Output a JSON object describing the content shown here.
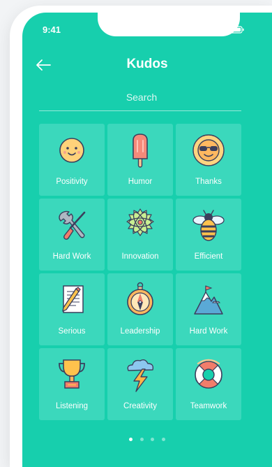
{
  "status": {
    "time": "9:41"
  },
  "nav": {
    "title": "Kudos"
  },
  "search": {
    "placeholder": "Search"
  },
  "kudos": [
    {
      "label": "Positivity",
      "icon": "smiley-face-icon"
    },
    {
      "label": "Humor",
      "icon": "popsicle-icon"
    },
    {
      "label": "Thanks",
      "icon": "sunglasses-sun-icon"
    },
    {
      "label": "Hard Work",
      "icon": "wrench-screwdriver-icon"
    },
    {
      "label": "Innovation",
      "icon": "atom-icon"
    },
    {
      "label": "Efficient",
      "icon": "bee-icon"
    },
    {
      "label": "Serious",
      "icon": "notepad-pencil-icon"
    },
    {
      "label": "Leadership",
      "icon": "compass-icon"
    },
    {
      "label": "Hard Work",
      "icon": "mountain-icon"
    },
    {
      "label": "Listening",
      "icon": "trophy-icon"
    },
    {
      "label": "Creativity",
      "icon": "lightning-cloud-icon"
    },
    {
      "label": "Teamwork",
      "icon": "life-ring-icon"
    }
  ],
  "pagination": {
    "pages": 4,
    "active": 1
  },
  "colors": {
    "background": "#17cfad",
    "tile": "#3bd8bc"
  }
}
